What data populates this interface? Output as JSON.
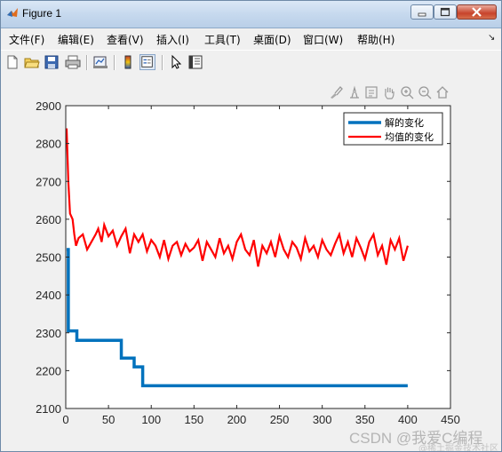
{
  "window": {
    "title": "Figure 1"
  },
  "menu": {
    "items": [
      "文件(F)",
      "编辑(E)",
      "查看(V)",
      "插入(I)",
      "工具(T)",
      "桌面(D)",
      "窗口(W)",
      "帮助(H)"
    ]
  },
  "toolbar": {
    "icons": [
      "new-figure-icon",
      "open-file-icon",
      "save-icon",
      "print-icon",
      "link-plot-icon",
      "colorbar-icon",
      "legend-icon",
      "pointer-icon",
      "property-inspector-icon"
    ]
  },
  "axes_toolbar": {
    "icons": [
      "brush-icon",
      "data-tips-icon",
      "rotate-icon",
      "pan-hand-icon",
      "zoom-in-icon",
      "zoom-out-icon",
      "home-icon"
    ]
  },
  "chart_data": {
    "type": "line",
    "xlim": [
      0,
      450
    ],
    "ylim": [
      2100,
      2900
    ],
    "xticks": [
      0,
      50,
      100,
      150,
      200,
      250,
      300,
      350,
      400,
      450
    ],
    "yticks": [
      2100,
      2200,
      2300,
      2400,
      2500,
      2600,
      2700,
      2800,
      2900
    ],
    "grid": false,
    "legend_position": "top-right",
    "series": [
      {
        "name": "解的变化",
        "color": "#0072bd",
        "style": "step",
        "x": [
          1,
          3,
          5,
          13,
          58,
          65,
          80,
          90,
          400
        ],
        "y": [
          2520,
          2305,
          2305,
          2280,
          2280,
          2233,
          2210,
          2160,
          2160
        ]
      },
      {
        "name": "均值的变化",
        "color": "#ff0000",
        "x": [
          1,
          3,
          5,
          8,
          10,
          12,
          15,
          20,
          25,
          30,
          35,
          38,
          42,
          45,
          50,
          55,
          60,
          65,
          70,
          75,
          80,
          85,
          90,
          95,
          100,
          105,
          110,
          115,
          120,
          125,
          130,
          135,
          140,
          145,
          150,
          155,
          160,
          165,
          170,
          175,
          180,
          185,
          190,
          195,
          200,
          205,
          210,
          215,
          220,
          225,
          230,
          235,
          240,
          245,
          250,
          255,
          260,
          265,
          270,
          275,
          280,
          285,
          290,
          295,
          300,
          305,
          310,
          315,
          320,
          325,
          330,
          335,
          340,
          345,
          350,
          355,
          360,
          365,
          370,
          375,
          380,
          385,
          390,
          395,
          400
        ],
        "y": [
          2840,
          2700,
          2615,
          2600,
          2560,
          2530,
          2550,
          2560,
          2520,
          2540,
          2560,
          2575,
          2540,
          2585,
          2555,
          2570,
          2530,
          2555,
          2575,
          2510,
          2560,
          2540,
          2560,
          2515,
          2545,
          2530,
          2500,
          2545,
          2495,
          2530,
          2540,
          2505,
          2535,
          2515,
          2525,
          2545,
          2490,
          2540,
          2520,
          2500,
          2550,
          2510,
          2530,
          2495,
          2540,
          2560,
          2520,
          2505,
          2545,
          2475,
          2530,
          2510,
          2540,
          2500,
          2555,
          2520,
          2500,
          2540,
          2525,
          2495,
          2550,
          2515,
          2530,
          2500,
          2545,
          2520,
          2505,
          2535,
          2560,
          2510,
          2540,
          2500,
          2550,
          2525,
          2495,
          2540,
          2560,
          2505,
          2530,
          2480,
          2545,
          2520,
          2550,
          2490,
          2530
        ]
      }
    ]
  },
  "watermark": {
    "main": "CSDN @我爱C编程",
    "sub": "@稀土掘金技术社区"
  }
}
